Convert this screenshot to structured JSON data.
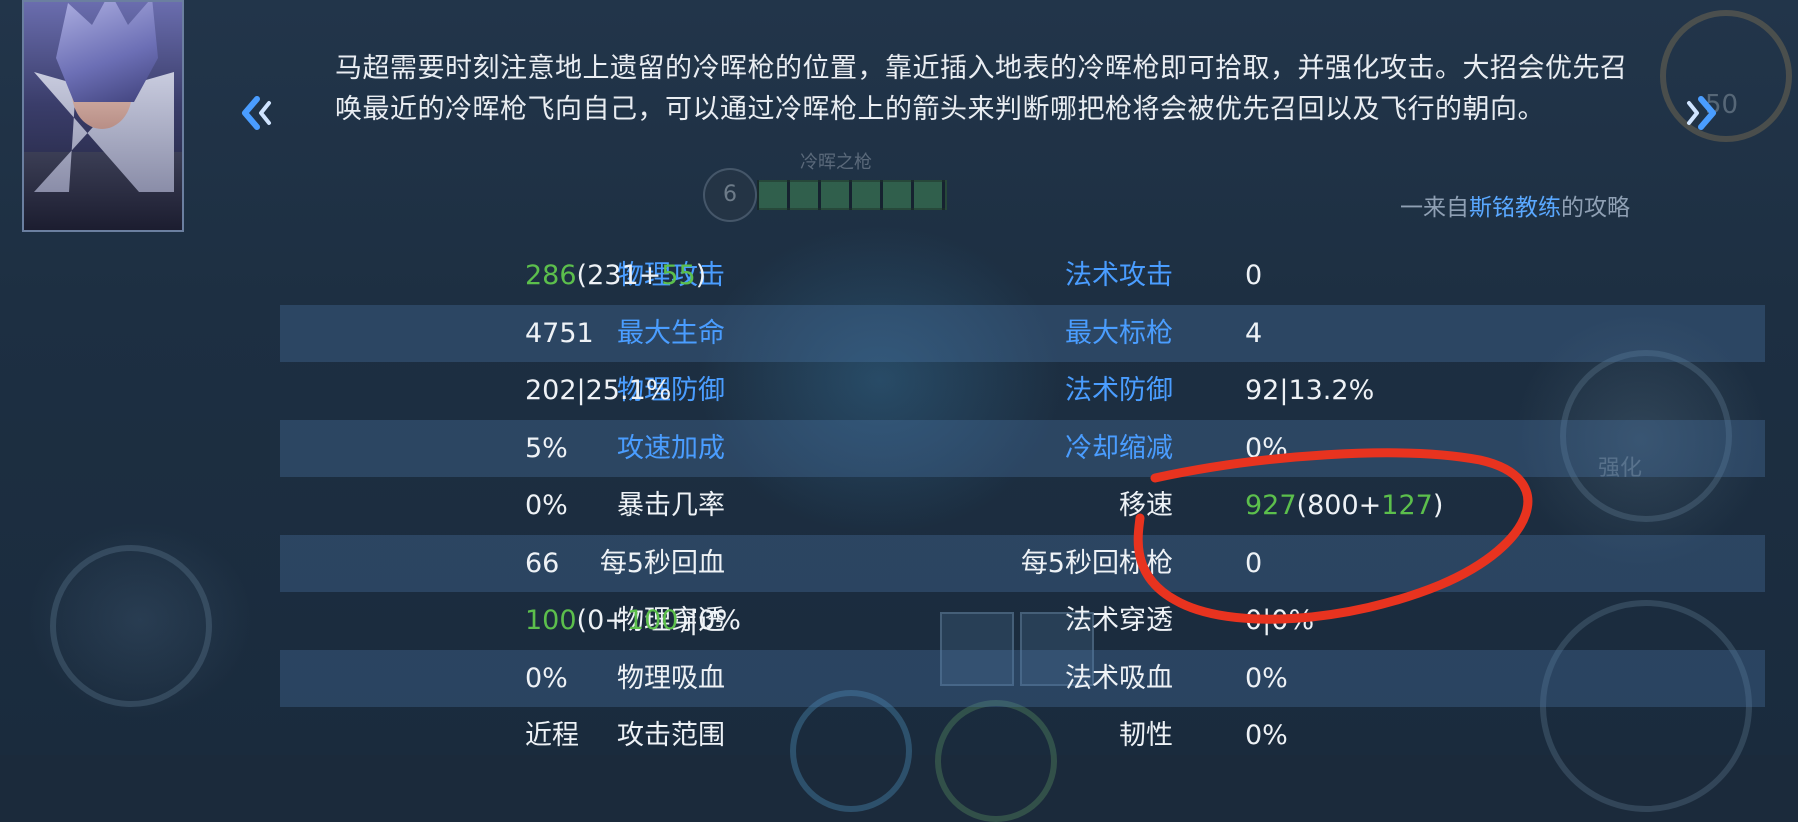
{
  "tip": {
    "text": "马超需要时刻注意地上遗留的冷晖枪的位置，靠近插入地表的冷晖枪即可拾取，并强化攻击。大招会优先召唤最近的冷晖枪飞向自己，可以通过冷晖枪上的箭头来判断哪把枪将会被优先召回以及飞行的朝向。",
    "source_prefix": "一来自",
    "source_author": "斯铭教练",
    "source_suffix": "的攻略"
  },
  "background": {
    "weapon_label": "冷晖之枪",
    "weapon_count": "6",
    "enhance_label": "强化",
    "hud_number": "50"
  },
  "stats": [
    {
      "left": {
        "label": "物理攻击",
        "label_color": "blue",
        "value": {
          "main": "286",
          "open": "(",
          "base": "231",
          "plus": "+",
          "bonus": "55",
          "close": ")"
        }
      },
      "right": {
        "label": "法术攻击",
        "label_color": "blue",
        "value": "0"
      }
    },
    {
      "left": {
        "label": "最大生命",
        "label_color": "blue",
        "value": "4751"
      },
      "right": {
        "label": "最大标枪",
        "label_color": "blue",
        "value": "4"
      }
    },
    {
      "left": {
        "label": "物理防御",
        "label_color": "blue",
        "value": "202|25.1%"
      },
      "right": {
        "label": "法术防御",
        "label_color": "blue",
        "value": "92|13.2%"
      }
    },
    {
      "left": {
        "label": "攻速加成",
        "label_color": "blue",
        "value": "5%"
      },
      "right": {
        "label": "冷却缩减",
        "label_color": "blue",
        "value": "0%"
      }
    },
    {
      "left": {
        "label": "暴击几率",
        "label_color": "white",
        "value": "0%"
      },
      "right": {
        "label": "移速",
        "label_color": "white",
        "value": {
          "main": "927",
          "open": "(",
          "base": "800",
          "plus": "+",
          "bonus": "127",
          "close": ")"
        }
      }
    },
    {
      "left": {
        "label": "每5秒回血",
        "label_color": "white",
        "value": "66"
      },
      "right": {
        "label": "每5秒回标枪",
        "label_color": "white",
        "value": "0"
      }
    },
    {
      "left": {
        "label": "物理穿透",
        "label_color": "white",
        "value": {
          "main": "100",
          "open": "(",
          "base": "0",
          "plus": "+",
          "bonus": "100",
          "close": ")",
          "suffix": "|0%"
        }
      },
      "right": {
        "label": "法术穿透",
        "label_color": "white",
        "value": "0|0%"
      }
    },
    {
      "left": {
        "label": "物理吸血",
        "label_color": "white",
        "value": "0%"
      },
      "right": {
        "label": "法术吸血",
        "label_color": "white",
        "value": "0%"
      }
    },
    {
      "left": {
        "label": "攻击范围",
        "label_color": "white",
        "value": "近程"
      },
      "right": {
        "label": "韧性",
        "label_color": "white",
        "value": "0%"
      }
    }
  ],
  "colors": {
    "label_blue": "#4a9dff",
    "bonus_green": "#5cbf4c",
    "annotation_red": "#e8331f",
    "row_highlight": "#4e7aaa"
  },
  "icons": {
    "prev": "chevron-left-double-icon",
    "next": "chevron-right-double-icon"
  }
}
